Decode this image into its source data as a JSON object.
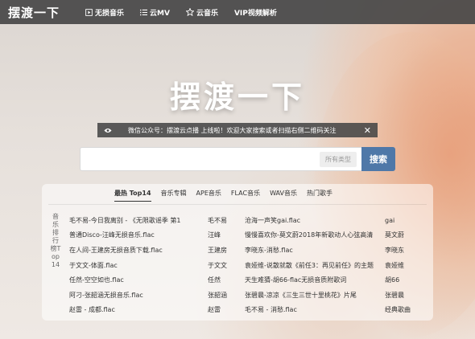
{
  "header": {
    "logo": "摆渡一下",
    "nav": [
      {
        "label": "无损音乐",
        "icon": "play-square-icon"
      },
      {
        "label": "云MV",
        "icon": "list-icon"
      },
      {
        "label": "云音乐",
        "icon": "star-icon"
      },
      {
        "label": "VIP视频解析",
        "icon": ""
      }
    ]
  },
  "hero": {
    "title": "摆渡一下"
  },
  "notice": {
    "text": "微信公众号：摆渡云点播 上线啦！欢迎大家搜索或者扫描右侧二维码关注"
  },
  "search": {
    "placeholder": "",
    "type_label": "所有类型",
    "button_label": "搜索"
  },
  "panel": {
    "tabs": [
      "最热 Top14",
      "音乐专辑",
      "APE音乐",
      "FLAC音乐",
      "WAV音乐",
      "热门歌手"
    ],
    "active_tab": 0,
    "side_label": "音乐排行榜Top14",
    "rows": [
      {
        "song1": "毛不易-今日我离别 - 《无限歌谣季 第1",
        "artist1": "毛不易",
        "song2": "沧海一声笑gai.flac",
        "artist2": "gai"
      },
      {
        "song1": "普通Disco-汪峰无损音乐.flac",
        "artist1": "汪峰",
        "song2": "慢慢喜欢你-莫文蔚2018年新歌动人心弦高清",
        "artist2": "莫文蔚"
      },
      {
        "song1": "在人间-王建房无损音质下载.flac",
        "artist1": "王建房",
        "song2": "李晓东-消愁.flac",
        "artist2": "李晓东"
      },
      {
        "song1": "于文文-体面.flac",
        "artist1": "于文文",
        "song2": "袁娅维-说散就散《前任3：再见前任》的主题",
        "artist2": "袁娅维"
      },
      {
        "song1": "任然-空空如也.flac",
        "artist1": "任然",
        "song2": "天生难猜-胡66-flac无损音质附歌词",
        "artist2": "胡66"
      },
      {
        "song1": "阿刁-张韶涵无损音乐.flac",
        "artist1": "张韶涵",
        "song2": "张碧晨-凉凉《三生三世十里桃花》片尾",
        "artist2": "张碧晨"
      },
      {
        "song1": "赵雷 - 成都.flac",
        "artist1": "赵雷",
        "song2": "毛不易 - 消愁.flac",
        "artist2": "经典歌曲"
      }
    ]
  }
}
